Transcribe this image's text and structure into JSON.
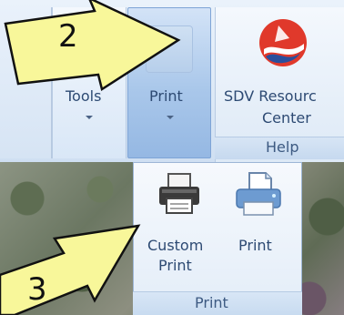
{
  "ribbon": {
    "tools": {
      "label": "Tools"
    },
    "print": {
      "label": "Print"
    },
    "sdv": {
      "line1": "SDV Resourc",
      "line2": "Center"
    },
    "help_group": {
      "label": "Help"
    }
  },
  "dropdown": {
    "custom_print": {
      "line1": "Custom",
      "line2": "Print"
    },
    "print": {
      "label": "Print"
    },
    "group_label": "Print"
  },
  "annotations": {
    "arrow2": {
      "number": "2"
    },
    "arrow3": {
      "number": "3"
    }
  },
  "colors": {
    "arrow_fill": "#f8f79a",
    "ribbon_text": "#2d4a73",
    "print_button_active": "#a9c7ea",
    "logo_red": "#e0392b",
    "logo_blue": "#2a4f9c"
  }
}
